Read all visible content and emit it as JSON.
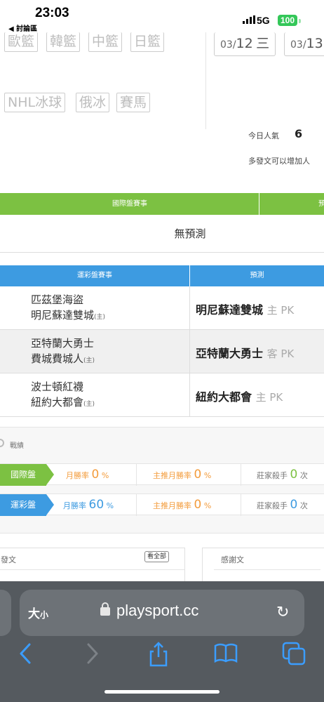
{
  "status": {
    "time": "23:03",
    "back_app": "◀ 討論區",
    "network": "5G",
    "battery": "100"
  },
  "league_tags_row1": [
    "歐籃",
    "韓籃",
    "中籃",
    "日籃"
  ],
  "league_tags_row2": [
    "NHL冰球",
    "俄冰",
    "賽馬"
  ],
  "dates": [
    {
      "md": "03/",
      "day": "12",
      "wd": "三"
    },
    {
      "md": "03/",
      "day": "13",
      "wd": ""
    }
  ],
  "popularity": {
    "label": "今日人氣",
    "value": "6",
    "hint": "多發文可以增加人"
  },
  "international": {
    "header": "國際盤賽事",
    "header2": "預",
    "no_prediction": "無預測"
  },
  "lottery": {
    "header": "運彩盤賽事",
    "pred_header": "預測",
    "rows": [
      {
        "away": "匹茲堡海盜",
        "home": "明尼蘇達雙城",
        "home_mark": "(主)",
        "pick": "明尼蘇達雙城",
        "side": "主 PK"
      },
      {
        "away": "亞特蘭大勇士",
        "home": "費城費城人",
        "home_mark": "(主)",
        "pick": "亞特蘭大勇士",
        "side": "客 PK"
      },
      {
        "away": "波士頓紅襪",
        "home": "紐約大都會",
        "home_mark": "(主)",
        "pick": "紐約大都會",
        "side": "主 PK"
      }
    ]
  },
  "record": {
    "title": "戰績",
    "rows": [
      {
        "label": "國際盤",
        "color": "#7cc142",
        "monthly_label": "月勝率",
        "monthly": "0",
        "main_label": "主推月勝率",
        "main": "0",
        "killer_label": "莊家殺手",
        "killer": "0",
        "unit": "次",
        "pct": "%"
      },
      {
        "label": "運彩盤",
        "color": "#3d9be1",
        "monthly_label": "月勝率",
        "monthly": "60",
        "main_label": "主推月勝率",
        "main": "0",
        "killer_label": "莊家殺手",
        "killer": "0",
        "unit": "次",
        "pct": "%"
      }
    ]
  },
  "posts": {
    "left_title": "發文",
    "see_all": "看全部",
    "right_title": "感謝文"
  },
  "browser": {
    "text_size": "大",
    "text_size_small": "小",
    "url": "playsport.cc"
  },
  "colors": {
    "intl": "#7cc142",
    "lottery": "#3d9be1",
    "orange": "#f39c3c",
    "browser_bg": "#555a5f",
    "accent": "#3b9dff"
  }
}
